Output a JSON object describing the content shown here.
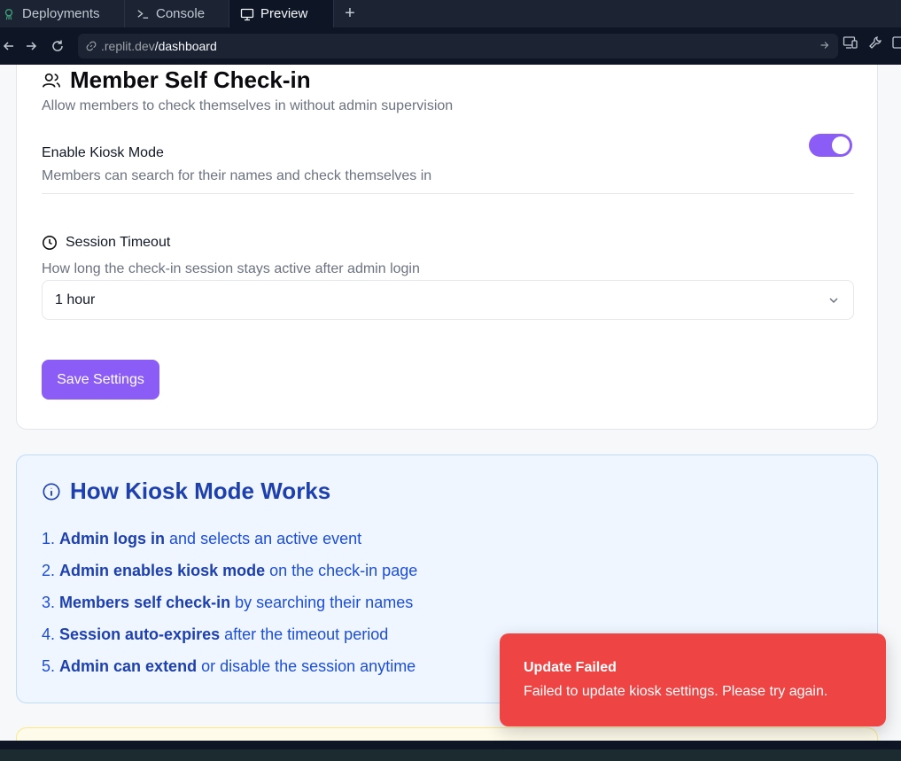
{
  "tabs": [
    {
      "label": "Deployments",
      "icon": "deployments-icon"
    },
    {
      "label": "Console",
      "icon": "terminal-icon"
    },
    {
      "label": "Preview",
      "icon": "monitor-icon",
      "active": true
    }
  ],
  "url": {
    "host": ".replit.dev",
    "path": "/dashboard"
  },
  "settings_card": {
    "title": "Member Self Check-in",
    "subtitle": "Allow members to check themselves in without admin supervision",
    "kiosk_label": "Enable Kiosk Mode",
    "kiosk_desc": "Members can search for their names and check themselves in",
    "kiosk_enabled": true,
    "timeout_label": "Session Timeout",
    "timeout_desc": "How long the check-in session stays active after admin login",
    "timeout_value": "1 hour",
    "save_label": "Save Settings"
  },
  "info_card": {
    "title": "How Kiosk Mode Works",
    "steps": [
      {
        "num": "1.",
        "bold": "Admin logs in",
        "rest": " and selects an active event"
      },
      {
        "num": "2.",
        "bold": "Admin enables kiosk mode",
        "rest": " on the check-in page"
      },
      {
        "num": "3.",
        "bold": "Members self check-in",
        "rest": " by searching their names"
      },
      {
        "num": "4.",
        "bold": "Session auto-expires",
        "rest": " after the timeout period"
      },
      {
        "num": "5.",
        "bold": "Admin can extend",
        "rest": " or disable the session anytime"
      }
    ]
  },
  "toast": {
    "title": "Update Failed",
    "message": "Failed to update kiosk settings. Please try again."
  },
  "colors": {
    "accent": "#8b5cf6",
    "info_text": "#1e40af",
    "error": "#ef4444"
  }
}
